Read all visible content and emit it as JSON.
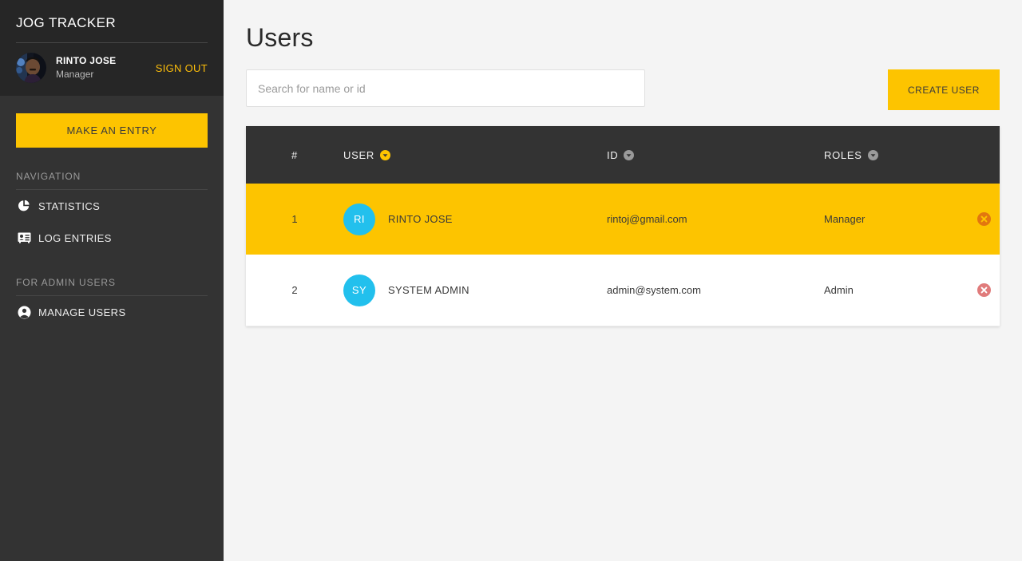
{
  "sidebar": {
    "brand": "JOG TRACKER",
    "profile": {
      "avatar_icon": "user-photo-avatar",
      "name": "RINTO JOSE",
      "role": "Manager",
      "signout_label": "SIGN OUT"
    },
    "entry_button_label": "MAKE AN ENTRY",
    "sections": [
      {
        "title": "NAVIGATION",
        "items": [
          {
            "label": "STATISTICS",
            "icon": "pie-chart-icon"
          },
          {
            "label": "LOG ENTRIES",
            "icon": "id-card-icon"
          }
        ]
      },
      {
        "title": "FOR ADMIN USERS",
        "items": [
          {
            "label": "MANAGE USERS",
            "icon": "user-circle-icon"
          }
        ]
      }
    ]
  },
  "main": {
    "page_title": "Users",
    "search": {
      "placeholder": "Search for name or id",
      "value": ""
    },
    "create_user_label": "CREATE USER",
    "table": {
      "columns": [
        {
          "key": "num",
          "label": "#",
          "sort_icon": null,
          "sort_active": false
        },
        {
          "key": "user",
          "label": "USER",
          "sort_icon": "sort-down-icon",
          "sort_active": true
        },
        {
          "key": "id",
          "label": "ID",
          "sort_icon": "sort-down-icon",
          "sort_active": false
        },
        {
          "key": "roles",
          "label": "ROLES",
          "sort_icon": "sort-down-icon",
          "sort_active": false
        },
        {
          "key": "actions",
          "label": "",
          "sort_icon": null,
          "sort_active": false
        }
      ],
      "rows": [
        {
          "num": "1",
          "initials": "RI",
          "user": "RINTO JOSE",
          "id": "rintoj@gmail.com",
          "roles": "Manager",
          "delete_icon": "delete-circle-icon",
          "highlighted": true
        },
        {
          "num": "2",
          "initials": "SY",
          "user": "SYSTEM ADMIN",
          "id": "admin@system.com",
          "roles": "Admin",
          "delete_icon": "delete-circle-icon",
          "highlighted": false
        }
      ]
    }
  },
  "colors": {
    "accent_amber": "#fdc400",
    "sidebar_dark": "#333333",
    "sidebar_header_dark": "#262626",
    "avatar_cyan": "#22c0ed",
    "delete_red": "#e07b7b",
    "page_bg": "#f4f4f4"
  }
}
